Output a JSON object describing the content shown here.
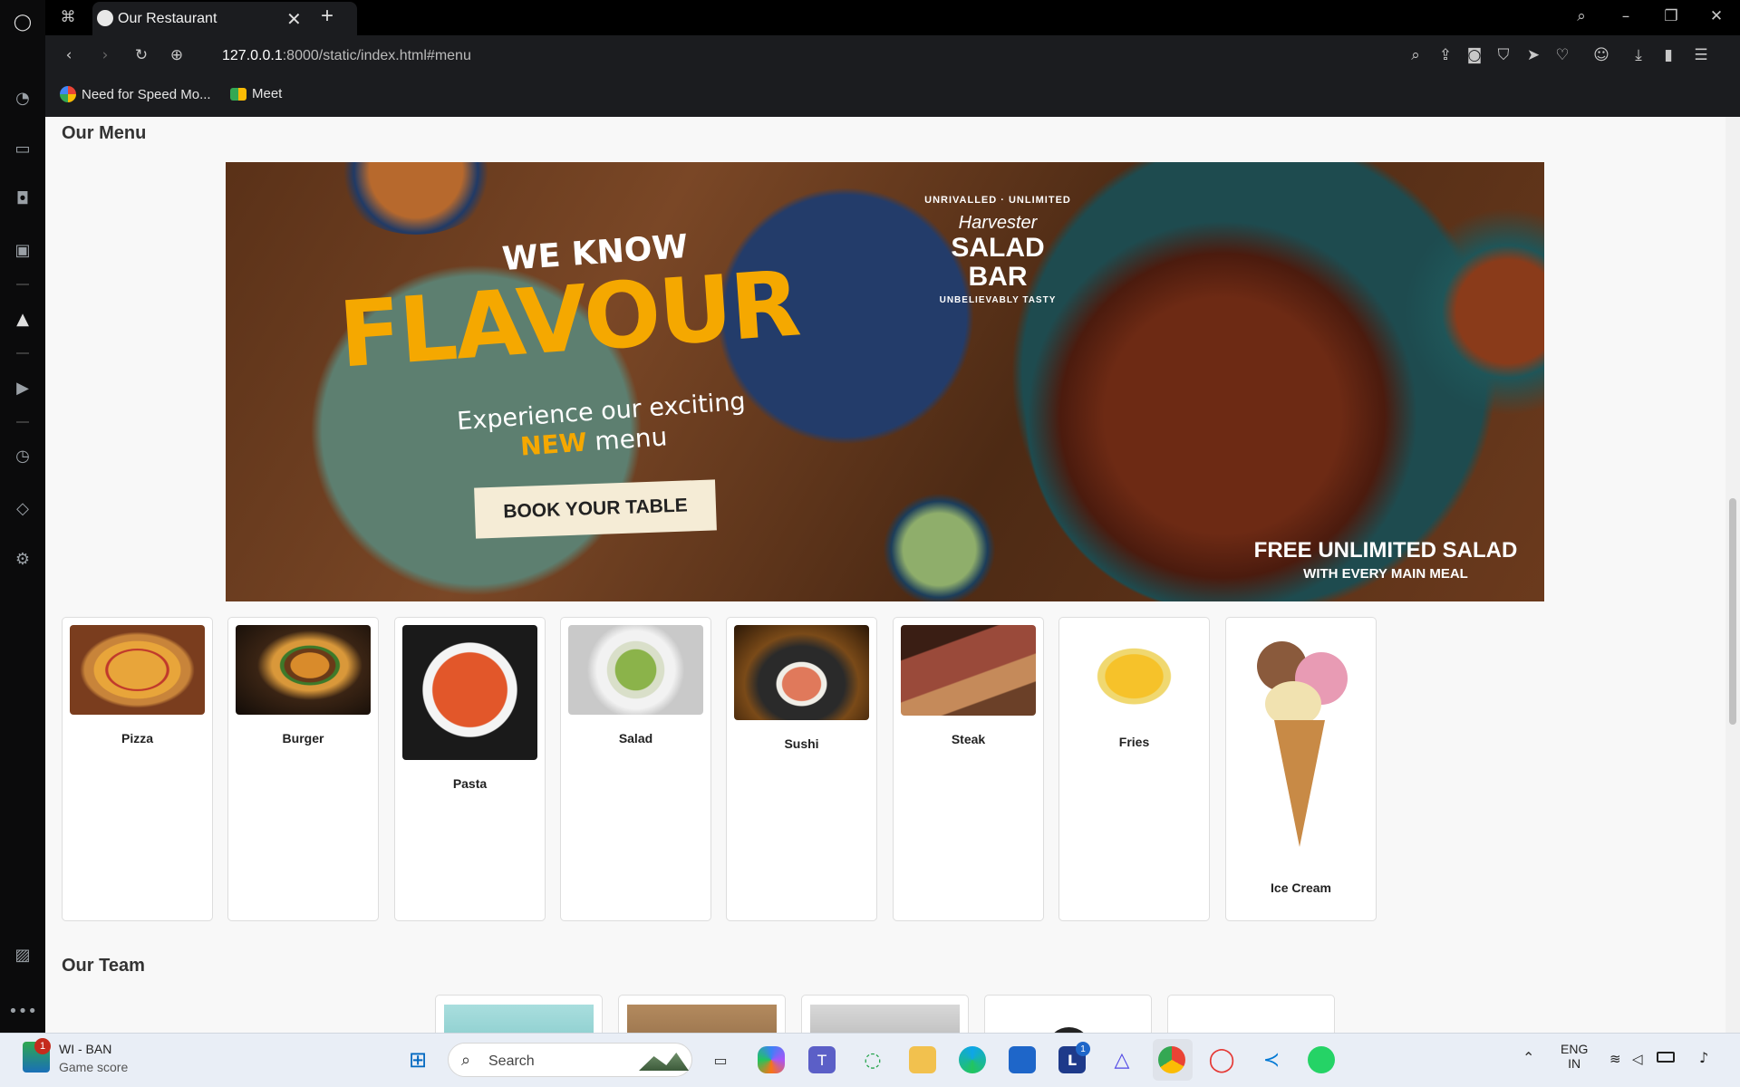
{
  "browser": {
    "tab_title": "Our Restaurant",
    "new_tab": "+",
    "url_host": "127.0.0.1",
    "url_rest": ":8000/static/index.html#menu",
    "bookmarks": [
      {
        "label": "Need for Speed Mo...",
        "icon": "google-icon"
      },
      {
        "label": "Meet",
        "icon": "meet-icon"
      }
    ]
  },
  "page": {
    "menu_heading": "Our Menu",
    "team_heading": "Our Team",
    "banner": {
      "line1": "WE KNOW",
      "line2": "FLAVOUR",
      "line3": "Experience our exciting",
      "line4_new": "NEW",
      "line4_menu": "menu",
      "cta": "BOOK YOUR TABLE",
      "badge_top": "UNRIVALLED · UNLIMITED",
      "badge_brand": "Harvester",
      "badge_title1": "SALAD",
      "badge_title2": "BAR",
      "badge_bottom": "UNBELIEVABLY TASTY",
      "offer1": "FREE UNLIMITED SALAD",
      "offer2": "WITH EVERY MAIN MEAL"
    },
    "menu_items": [
      {
        "name": "Pizza"
      },
      {
        "name": "Burger"
      },
      {
        "name": "Pasta"
      },
      {
        "name": "Salad"
      },
      {
        "name": "Sushi"
      },
      {
        "name": "Steak"
      },
      {
        "name": "Fries"
      },
      {
        "name": "Ice Cream"
      }
    ]
  },
  "taskbar": {
    "weather_title": "WI - BAN",
    "weather_sub": "Game score",
    "weather_badge": "1",
    "search_placeholder": "Search",
    "lang": "ENG",
    "region": "IN",
    "app_badge": "1"
  },
  "colors": {
    "accent_yellow": "#f5a800",
    "page_bg": "#f8f8f8",
    "chrome_bg": "#1b1c1f"
  }
}
